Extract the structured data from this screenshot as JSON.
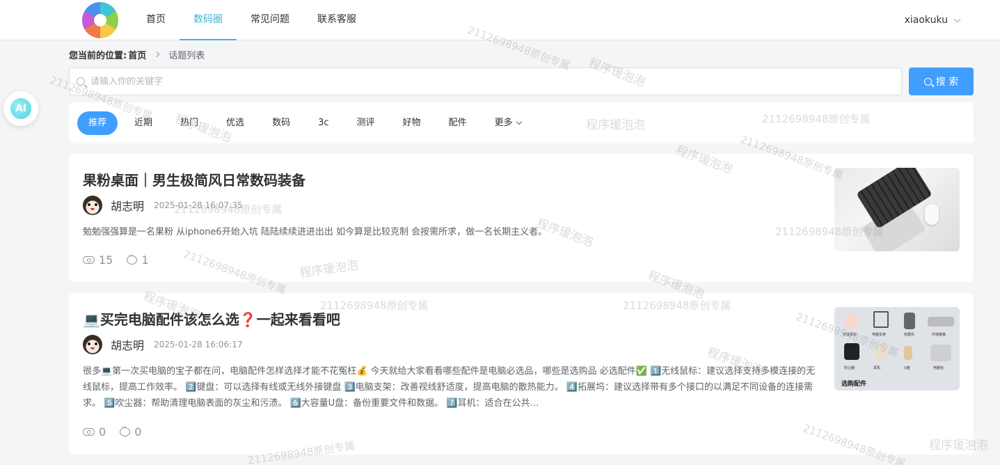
{
  "header": {
    "nav": [
      "首页",
      "数码圈",
      "常见问题",
      "联系客服"
    ],
    "active_nav": "数码圈",
    "username": "xiaokuku"
  },
  "breadcrumb": {
    "label": "您当前的位置:",
    "home": "首页",
    "current": "话题列表"
  },
  "search": {
    "placeholder": "请输入你的关键字",
    "button_label": "搜 索"
  },
  "ai_button": {
    "label": "AI"
  },
  "categories": {
    "items": [
      "推荐",
      "近期",
      "热门",
      "优选",
      "数码",
      "3c",
      "测评",
      "好物",
      "配件",
      "更多"
    ],
    "active": "推荐"
  },
  "posts": [
    {
      "title": "果粉桌面｜男生极简风日常数码装备",
      "author": "胡志明",
      "time": "2025-01-28 16:07:35",
      "excerpt": "勉勉强强算是一名果粉 从iphone6开始入坑 陆陆续续进进出出 如今算是比较克制 会按需所求，做一名长期主义者。",
      "views": "15",
      "comments": "1"
    },
    {
      "title": "💻买完电脑配件该怎么选❓一起来看看吧",
      "author": "胡志明",
      "time": "2025-01-28 16:06:17",
      "excerpt": "很多💻第一次买电脑的宝子都在问，电脑配件怎样选择才能不花冤枉💰 今天就给大家看看哪些配件是电脑必选品，哪些是选购品 必选配件✅ 1️⃣无线鼠标：建议选择支持多模连接的无线鼠标，提高工作效率。 2️⃣键盘：可以选择有线或无线外接键盘 3️⃣电脑支架：改善视线舒适度，提高电脑的散热能力。 4️⃣拓展坞：建议选择带有多个接口的以满足不同设备的连接需求。 5️⃣吹尘器：帮助清理电脑表面的灰尘和污渍。 6️⃣大容量U盘：备份重要文件和数据。 7️⃣耳机：适合在公共…",
      "views": "0",
      "comments": "0",
      "thumb_caption": "选购配件",
      "thumb_labels": [
        "无线鼠标",
        "电脑支架",
        "拓展坞",
        "外接键盘",
        "吹尘器",
        "耳机",
        "U盘",
        "电脑包"
      ]
    }
  ],
  "watermarks": [
    "2112698948原创专属",
    "程序瑗泡泡"
  ],
  "colors": {
    "accent": "#409eff",
    "nav_active": "#39b7d6"
  }
}
